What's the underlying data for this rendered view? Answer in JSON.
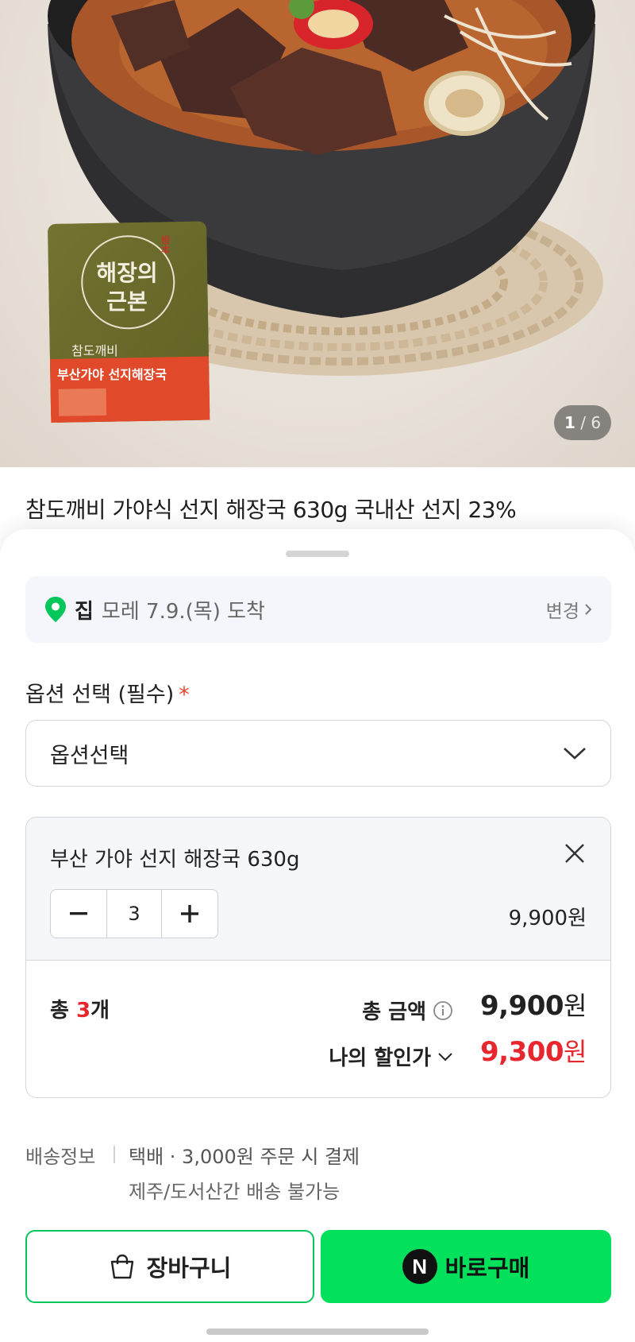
{
  "hero": {
    "package_brand_line1": "해장의",
    "package_brand_line2": "근본",
    "package_seal": "根本",
    "package_maker": "참도깨비",
    "package_product": "부산가야 선지해장국",
    "counter_current": "1",
    "counter_total": "6"
  },
  "product": {
    "title": "참도깨비 가야식 선지 해장국 630g 국내산 선지 23%"
  },
  "delivery": {
    "place": "집",
    "date_text": "모레 7.9.(목) 도착",
    "change_label": "변경",
    "pin_color": "#03c75a"
  },
  "option": {
    "label": "옵션 선택 (필수)",
    "required_mark": "*",
    "select_value": "옵션선택"
  },
  "item": {
    "name": "부산 가야 선지 해장국 630g",
    "quantity": "3",
    "price": "9,900원"
  },
  "total": {
    "count_prefix": "총 ",
    "count_value": "3",
    "count_suffix": "개",
    "sum_label": "총 금액",
    "sum_number": "9,900",
    "sum_unit": "원",
    "discount_label": "나의 할인가",
    "discount_number": "9,300",
    "discount_unit": "원"
  },
  "shipping": {
    "label": "배송정보",
    "line1": "택배 · 3,000원 주문 시 결제",
    "line2": "제주/도서산간 배송 불가능"
  },
  "actions": {
    "cart_label": "장바구니",
    "buy_label": "바로구매",
    "npay_glyph": "N"
  },
  "colors": {
    "accent_green": "#03c75a",
    "buy_green": "#03e05b",
    "price_red": "#e8262e"
  }
}
